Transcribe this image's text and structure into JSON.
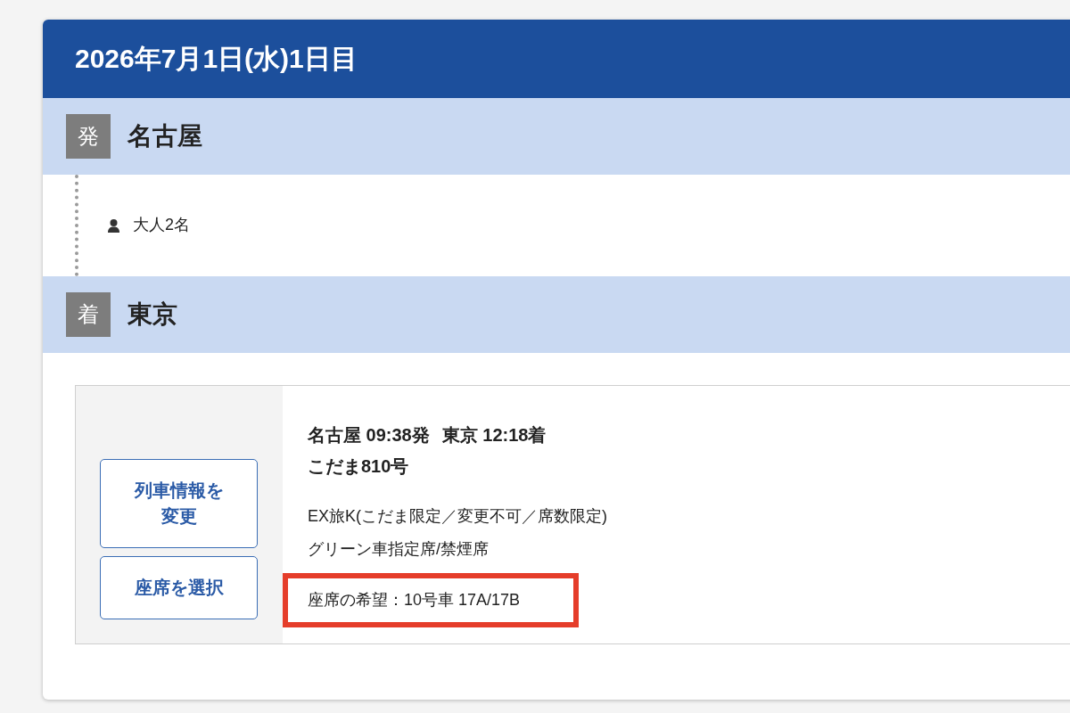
{
  "day_header": {
    "title": "2026年7月1日(水)1日目"
  },
  "route": [
    {
      "kind": "station",
      "badge": "発",
      "name": "名古屋"
    },
    {
      "kind": "passengers",
      "text": "大人2名"
    },
    {
      "kind": "station",
      "badge": "着",
      "name": "東京"
    }
  ],
  "train": {
    "buttons": [
      "列車情報を変更",
      "座席を選択"
    ],
    "departure": "名古屋 09:38発",
    "arrival": "東京 12:18着",
    "name": "こだま810号",
    "details": [
      {
        "text": "EX旅K(こだま限定／変更不可／席数限定)",
        "highlighted": false
      },
      {
        "text": "グリーン車指定席/禁煙席",
        "highlighted": false
      },
      {
        "text": "座席の希望：10号車 17A/17B",
        "highlighted": true
      }
    ]
  }
}
